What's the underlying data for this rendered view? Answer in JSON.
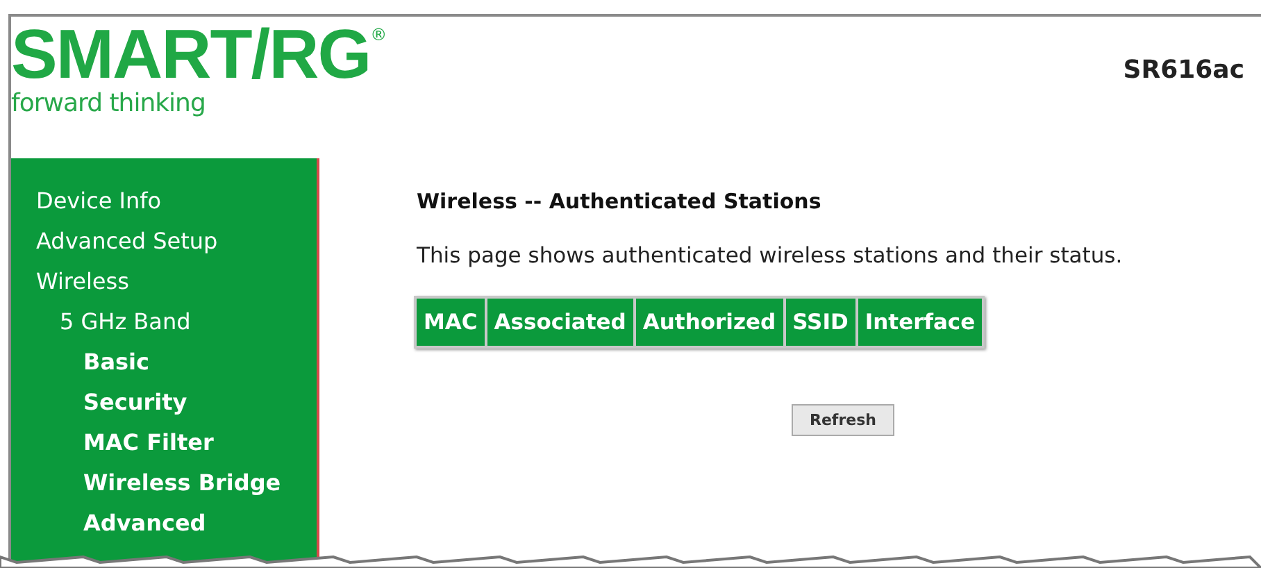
{
  "header": {
    "logo": "SMART/RG",
    "registered_mark": "®",
    "tagline": "forward thinking",
    "model": "SR616ac"
  },
  "sidebar": {
    "items": [
      {
        "label": "Device Info"
      },
      {
        "label": "Advanced Setup"
      },
      {
        "label": "Wireless",
        "children": [
          {
            "label": "5 GHz Band",
            "children": [
              {
                "label": "Basic"
              },
              {
                "label": "Security"
              },
              {
                "label": "MAC Filter"
              },
              {
                "label": "Wireless Bridge"
              },
              {
                "label": "Advanced"
              }
            ]
          }
        ]
      }
    ]
  },
  "main": {
    "title": "Wireless -- Authenticated Stations",
    "description": "This page shows authenticated wireless stations and their status.",
    "table": {
      "columns": [
        "MAC",
        "Associated",
        "Authorized",
        "SSID",
        "Interface"
      ]
    },
    "buttons": [
      "Refresh"
    ]
  }
}
